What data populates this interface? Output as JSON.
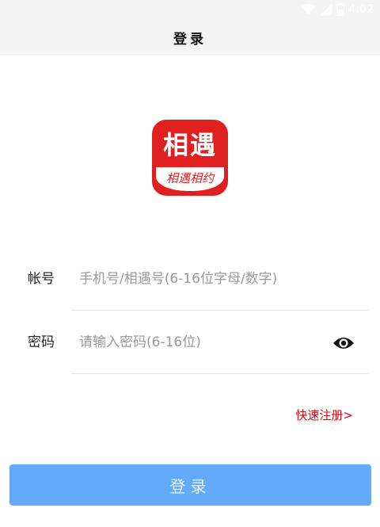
{
  "status_bar": {
    "time": "4:02",
    "icons": [
      "wifi-icon",
      "signal-icon",
      "battery-icon"
    ]
  },
  "header": {
    "title": "登录"
  },
  "logo": {
    "main_text": "相遇",
    "sub_text": "相遇相约",
    "brand_color": "#e02020"
  },
  "form": {
    "account": {
      "label": "帐号",
      "value": "",
      "placeholder": "手机号/相遇号(6-16位字母/数字)"
    },
    "password": {
      "label": "密码",
      "value": "",
      "placeholder": "请输入密码(6-16位)",
      "toggle_icon": "eye-icon"
    }
  },
  "register_link": "快速注册>",
  "login_button": {
    "label": "登录",
    "color": "#64aafa"
  },
  "colors": {
    "accent_red": "#e8000b",
    "header_bg": "#f4f4f4"
  }
}
